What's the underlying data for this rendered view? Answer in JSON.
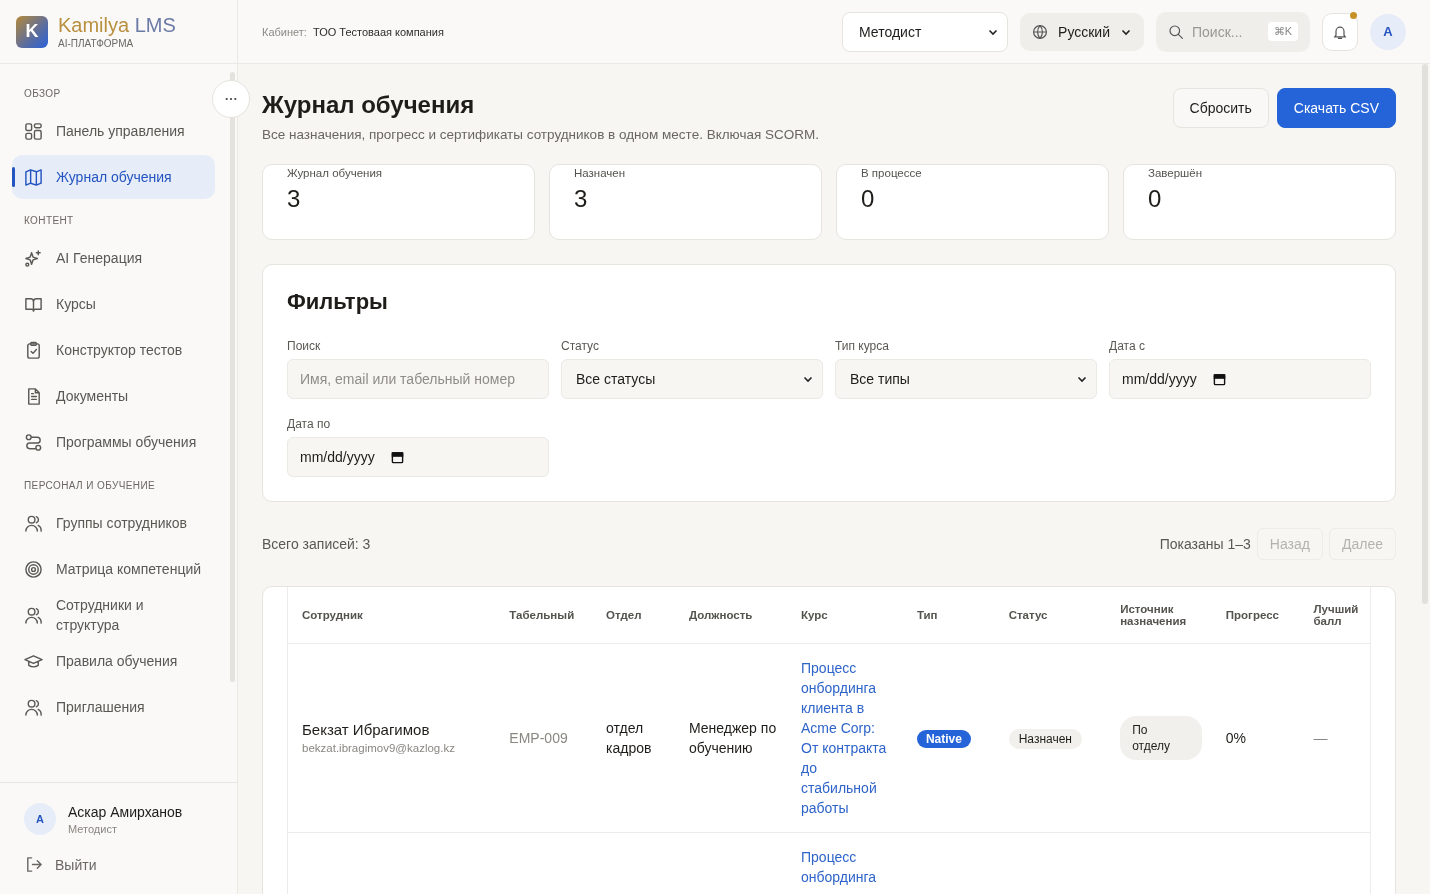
{
  "brand": {
    "logo_letter": "K",
    "name": "Kamilya",
    "name_suffix": "LMS",
    "tagline": "AI-ПЛАТФОРМА"
  },
  "header": {
    "cabinet_label": "Кабинет:",
    "cabinet_value": "ТОО Тестоваая компания",
    "role": "Методист",
    "language": "Русский",
    "search_placeholder": "Поиск...",
    "search_shortcut": "⌘K",
    "notification_dot": true,
    "avatar_letter": "A"
  },
  "sidebar": {
    "sections": [
      {
        "title": "ОБЗОР",
        "items": [
          {
            "label": "Панель управления",
            "kind": "grid",
            "selected": false
          },
          {
            "label": "Журнал обучения",
            "kind": "map",
            "selected": true
          }
        ]
      },
      {
        "title": "КОНТЕНТ",
        "items": [
          {
            "label": "AI Генерация",
            "kind": "sparkle",
            "selected": false
          },
          {
            "label": "Курсы",
            "kind": "book",
            "selected": false
          },
          {
            "label": "Конструктор тестов",
            "kind": "clipboard",
            "selected": false
          },
          {
            "label": "Документы",
            "kind": "document",
            "selected": false
          },
          {
            "label": "Программы обучения",
            "kind": "route",
            "selected": false
          }
        ]
      },
      {
        "title": "ПЕРСОНАЛ И ОБУЧЕНИЕ",
        "items": [
          {
            "label": "Группы сотрудников",
            "kind": "users",
            "selected": false
          },
          {
            "label": "Матрица компетенций",
            "kind": "target",
            "selected": false
          },
          {
            "label": "Сотрудники и структура",
            "kind": "users",
            "selected": false
          },
          {
            "label": "Правила обучения",
            "kind": "cap",
            "selected": false
          },
          {
            "label": "Приглашения",
            "kind": "users",
            "selected": false
          }
        ]
      }
    ],
    "user": {
      "avatar_letter": "A",
      "name": "Аскар Амирханов",
      "role": "Методист"
    },
    "logout": "Выйти"
  },
  "page": {
    "title": "Журнал обучения",
    "subtitle": "Все назначения, прогресс и сертификаты сотрудников в одном месте. Включая SCORM.",
    "buttons": [
      {
        "label": "Сбросить",
        "kind": "secondary"
      },
      {
        "label": "Скачать CSV",
        "kind": "primary"
      }
    ]
  },
  "stats": [
    {
      "label": "Журнал обучения",
      "value": "3"
    },
    {
      "label": "Назначен",
      "value": "3"
    },
    {
      "label": "В процессе",
      "value": "0"
    },
    {
      "label": "Завершён",
      "value": "0"
    }
  ],
  "filters": {
    "title": "Фильтры",
    "fields": [
      {
        "label": "Поиск",
        "kind": "text",
        "placeholder": "Имя, email или табельный номер"
      },
      {
        "label": "Статус",
        "kind": "select",
        "value": "Все статусы"
      },
      {
        "label": "Тип курса",
        "kind": "select",
        "value": "Все типы"
      },
      {
        "label": "Дата с",
        "kind": "date",
        "value": "mm/dd/yyyy"
      },
      {
        "label": "Дата по",
        "kind": "date",
        "value": "mm/dd/yyyy"
      }
    ]
  },
  "summary": {
    "total": "Всего записей: 3",
    "shown": "Показаны 1–3",
    "pager": [
      {
        "label": "Назад",
        "disabled": true
      },
      {
        "label": "Далее",
        "disabled": true
      }
    ]
  },
  "table": {
    "columns": [
      "Сотрудник",
      "Табельный",
      "Отдел",
      "Должность",
      "Курс",
      "Тип",
      "Статус",
      "Источник назначения",
      "Прогресс",
      "Лучший балл"
    ],
    "rows": [
      {
        "name": "Бекзат Ибрагимов",
        "email": "bekzat.ibragimov9@kazlog.kz",
        "employee_id": "EMP-009",
        "department": "отдел кадров",
        "position": "Менеджер по обучению",
        "course": "Процесс онбординга клиента в Acme Corp: От контракта до стабильной работы",
        "type": "Native",
        "status": "Назначен",
        "source": "По отделу",
        "progress": "0%",
        "best_score": "—"
      },
      {
        "course": "Процесс онбординга"
      }
    ]
  }
}
